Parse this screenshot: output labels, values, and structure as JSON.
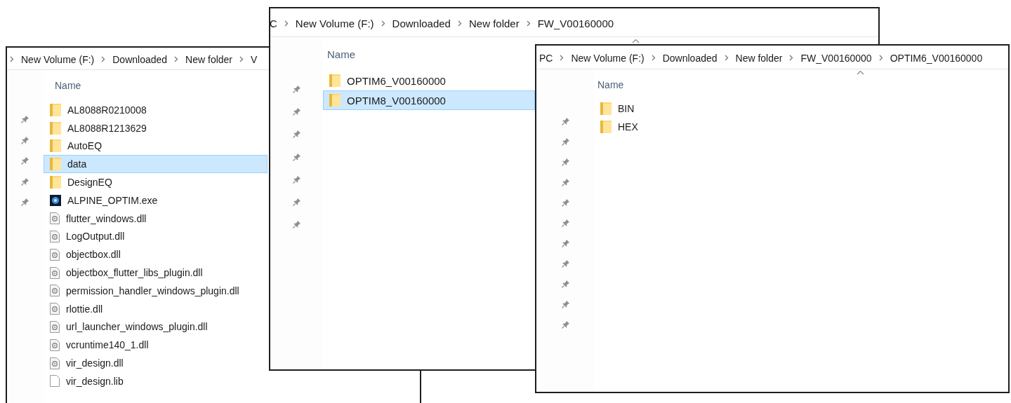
{
  "windows": [
    {
      "breadcrumb": {
        "leading_separator": true,
        "parts": [
          "New Volume (F:)",
          "Downloaded",
          "New folder",
          "V"
        ]
      },
      "column_header": "Name",
      "sort_caret": false,
      "quick_access": [
        {
          "pinned": true
        },
        {
          "pinned": true
        },
        {
          "pinned": true
        },
        {
          "pinned": true
        },
        {
          "pinned": true
        }
      ],
      "items": [
        {
          "name": "AL8088R0210008",
          "kind": "folder",
          "selected": false
        },
        {
          "name": "AL8088R1213629",
          "kind": "folder",
          "selected": false
        },
        {
          "name": "AutoEQ",
          "kind": "folder",
          "selected": false
        },
        {
          "name": "data",
          "kind": "folder",
          "selected": true
        },
        {
          "name": "DesignEQ",
          "kind": "folder",
          "selected": false
        },
        {
          "name": "ALPINE_OPTIM.exe",
          "kind": "exe",
          "selected": false
        },
        {
          "name": "flutter_windows.dll",
          "kind": "dll",
          "selected": false
        },
        {
          "name": "LogOutput.dll",
          "kind": "dll",
          "selected": false
        },
        {
          "name": "objectbox.dll",
          "kind": "dll",
          "selected": false
        },
        {
          "name": "objectbox_flutter_libs_plugin.dll",
          "kind": "dll",
          "selected": false
        },
        {
          "name": "permission_handler_windows_plugin.dll",
          "kind": "dll",
          "selected": false
        },
        {
          "name": "rlottie.dll",
          "kind": "dll",
          "selected": false
        },
        {
          "name": "url_launcher_windows_plugin.dll",
          "kind": "dll",
          "selected": false
        },
        {
          "name": "vcruntime140_1.dll",
          "kind": "dll",
          "selected": false
        },
        {
          "name": "vir_design.dll",
          "kind": "dll",
          "selected": false
        },
        {
          "name": "vir_design.lib",
          "kind": "file",
          "selected": false
        }
      ]
    },
    {
      "breadcrumb": {
        "leading_separator": false,
        "parts": [
          "C",
          "New Volume (F:)",
          "Downloaded",
          "New folder",
          "FW_V00160000"
        ]
      },
      "column_header": "Name",
      "sort_caret": true,
      "quick_access": [
        {
          "pinned": true
        },
        {
          "pinned": true
        },
        {
          "pinned": true
        },
        {
          "pinned": true
        },
        {
          "pinned": true
        },
        {
          "pinned": true
        },
        {
          "pinned": true
        }
      ],
      "items": [
        {
          "name": "OPTIM6_V00160000",
          "kind": "folder",
          "selected": false
        },
        {
          "name": "OPTIM8_V00160000",
          "kind": "folder",
          "selected": true
        }
      ]
    },
    {
      "breadcrumb": {
        "leading_separator": false,
        "parts": [
          "PC",
          "New Volume (F:)",
          "Downloaded",
          "New folder",
          "FW_V00160000",
          "OPTIM6_V00160000"
        ]
      },
      "column_header": "Name",
      "sort_caret": true,
      "quick_access": [
        {
          "pinned": true
        },
        {
          "pinned": true
        },
        {
          "pinned": true
        },
        {
          "pinned": true
        },
        {
          "pinned": true
        },
        {
          "pinned": true
        },
        {
          "pinned": true
        },
        {
          "pinned": true
        },
        {
          "pinned": true
        },
        {
          "pinned": true
        },
        {
          "pinned": true
        }
      ],
      "items": [
        {
          "name": "BIN",
          "kind": "folder",
          "selected": false
        },
        {
          "name": "HEX",
          "kind": "folder",
          "selected": false
        }
      ]
    }
  ]
}
